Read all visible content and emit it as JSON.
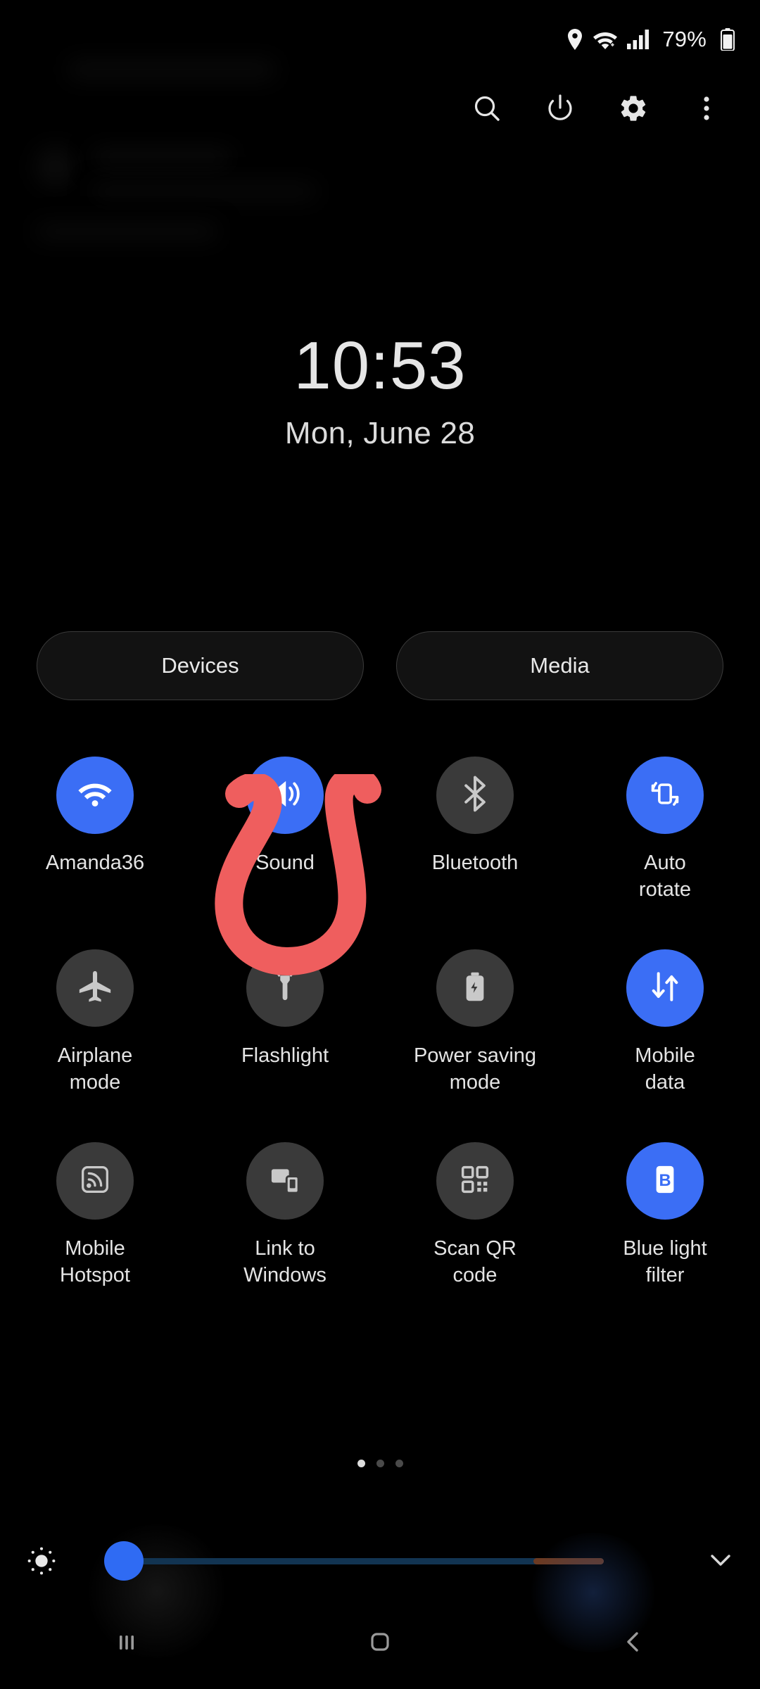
{
  "status_bar": {
    "battery_percent": "79%",
    "icons": [
      "location-icon",
      "wifi-icon",
      "signal-icon",
      "battery-icon"
    ]
  },
  "header_toolbar": {
    "buttons": [
      {
        "name": "search-icon",
        "label": "Search"
      },
      {
        "name": "power-icon",
        "label": "Power"
      },
      {
        "name": "gear-icon",
        "label": "Settings"
      },
      {
        "name": "more-options-icon",
        "label": "More options"
      }
    ]
  },
  "clock": {
    "time": "10:53",
    "date": "Mon, June 28"
  },
  "pills": [
    {
      "label": "Devices"
    },
    {
      "label": "Media"
    }
  ],
  "toggles": [
    [
      {
        "label": "Amanda36",
        "icon": "wifi-icon",
        "state": "on"
      },
      {
        "label": "Sound",
        "icon": "sound-icon",
        "state": "on"
      },
      {
        "label": "Bluetooth",
        "icon": "bluetooth-icon",
        "state": "off"
      },
      {
        "label": "Auto\nrotate",
        "icon": "auto-rotate-icon",
        "state": "on"
      }
    ],
    [
      {
        "label": "Airplane\nmode",
        "icon": "airplane-icon",
        "state": "off"
      },
      {
        "label": "Flashlight",
        "icon": "flashlight-icon",
        "state": "off"
      },
      {
        "label": "Power saving\nmode",
        "icon": "power-saving-icon",
        "state": "off"
      },
      {
        "label": "Mobile\ndata",
        "icon": "mobile-data-icon",
        "state": "on"
      }
    ],
    [
      {
        "label": "Mobile\nHotspot",
        "icon": "hotspot-icon",
        "state": "off"
      },
      {
        "label": "Link to\nWindows",
        "icon": "link-to-windows-icon",
        "state": "off"
      },
      {
        "label": "Scan QR\ncode",
        "icon": "qr-code-icon",
        "state": "off"
      },
      {
        "label": "Blue light\nfilter",
        "icon": "blue-light-filter-icon",
        "state": "on"
      }
    ]
  ],
  "page_dots": {
    "count": 3,
    "active_index": 0
  },
  "brightness": {
    "icon": "brightness-icon",
    "value_percent": 2,
    "expand_icon": "chevron-down-icon"
  },
  "nav_bar": {
    "buttons": [
      {
        "name": "recents-icon",
        "label": "Recents"
      },
      {
        "name": "home-icon",
        "label": "Home"
      },
      {
        "name": "back-icon",
        "label": "Back"
      }
    ]
  },
  "annotation": {
    "type": "handwritten-mark",
    "shape": "U",
    "color": "#ef5e5e",
    "targets": "Scan QR code"
  },
  "colors": {
    "accent_blue": "#3b6ef5",
    "toggle_off": "#3a3a3a",
    "background": "#000000",
    "text_primary": "#e8e8e8",
    "annotation_red": "#ef5e5e"
  }
}
